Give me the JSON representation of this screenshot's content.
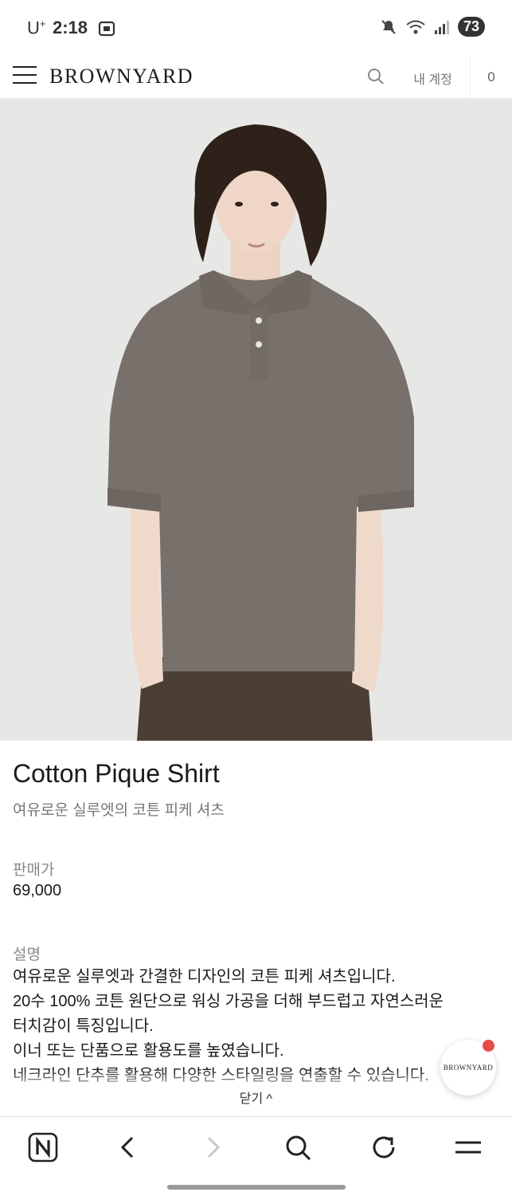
{
  "status_bar": {
    "carrier": "U",
    "carrier_sup": "+",
    "time": "2:18",
    "battery": "73"
  },
  "header": {
    "logo": "BROWNYARD",
    "account_label": "내 계정",
    "cart_count": "0"
  },
  "product": {
    "name": "Cotton Pique Shirt",
    "subtitle": "여유로운 실루엣의 코튼 피케 셔츠",
    "price_label": "판매가",
    "price": "69,000",
    "description_label": "설명",
    "description_lines": [
      "여유로운 실루엣과 간결한 디자인의 코튼 피케 셔츠입니다.",
      "20수 100% 코튼 원단으로 워싱 가공을 더해 부드럽고 자연스러운",
      "터치감이 특징입니다.",
      "이너 또는 단품으로 활용도를 높였습니다.",
      "네크라인 단추를 활용해 다양한 스타일링을 연출할 수 있습니다."
    ],
    "close_label": "닫기 ^"
  },
  "floating_badge": {
    "logo": "BROWNYARD"
  },
  "colors": {
    "background": "#ffffff",
    "image_bg": "#e6e6e6",
    "shirt": "#78706a",
    "pants": "#4a3d34",
    "notification_dot": "#e94a4a"
  },
  "icons": {
    "menu": "hamburger-icon",
    "search": "search-icon",
    "nav_home": "naver-n-icon",
    "nav_back": "chevron-left-icon",
    "nav_forward": "chevron-right-icon",
    "nav_search": "search-icon",
    "nav_refresh": "refresh-icon",
    "nav_menu": "menu-icon"
  }
}
